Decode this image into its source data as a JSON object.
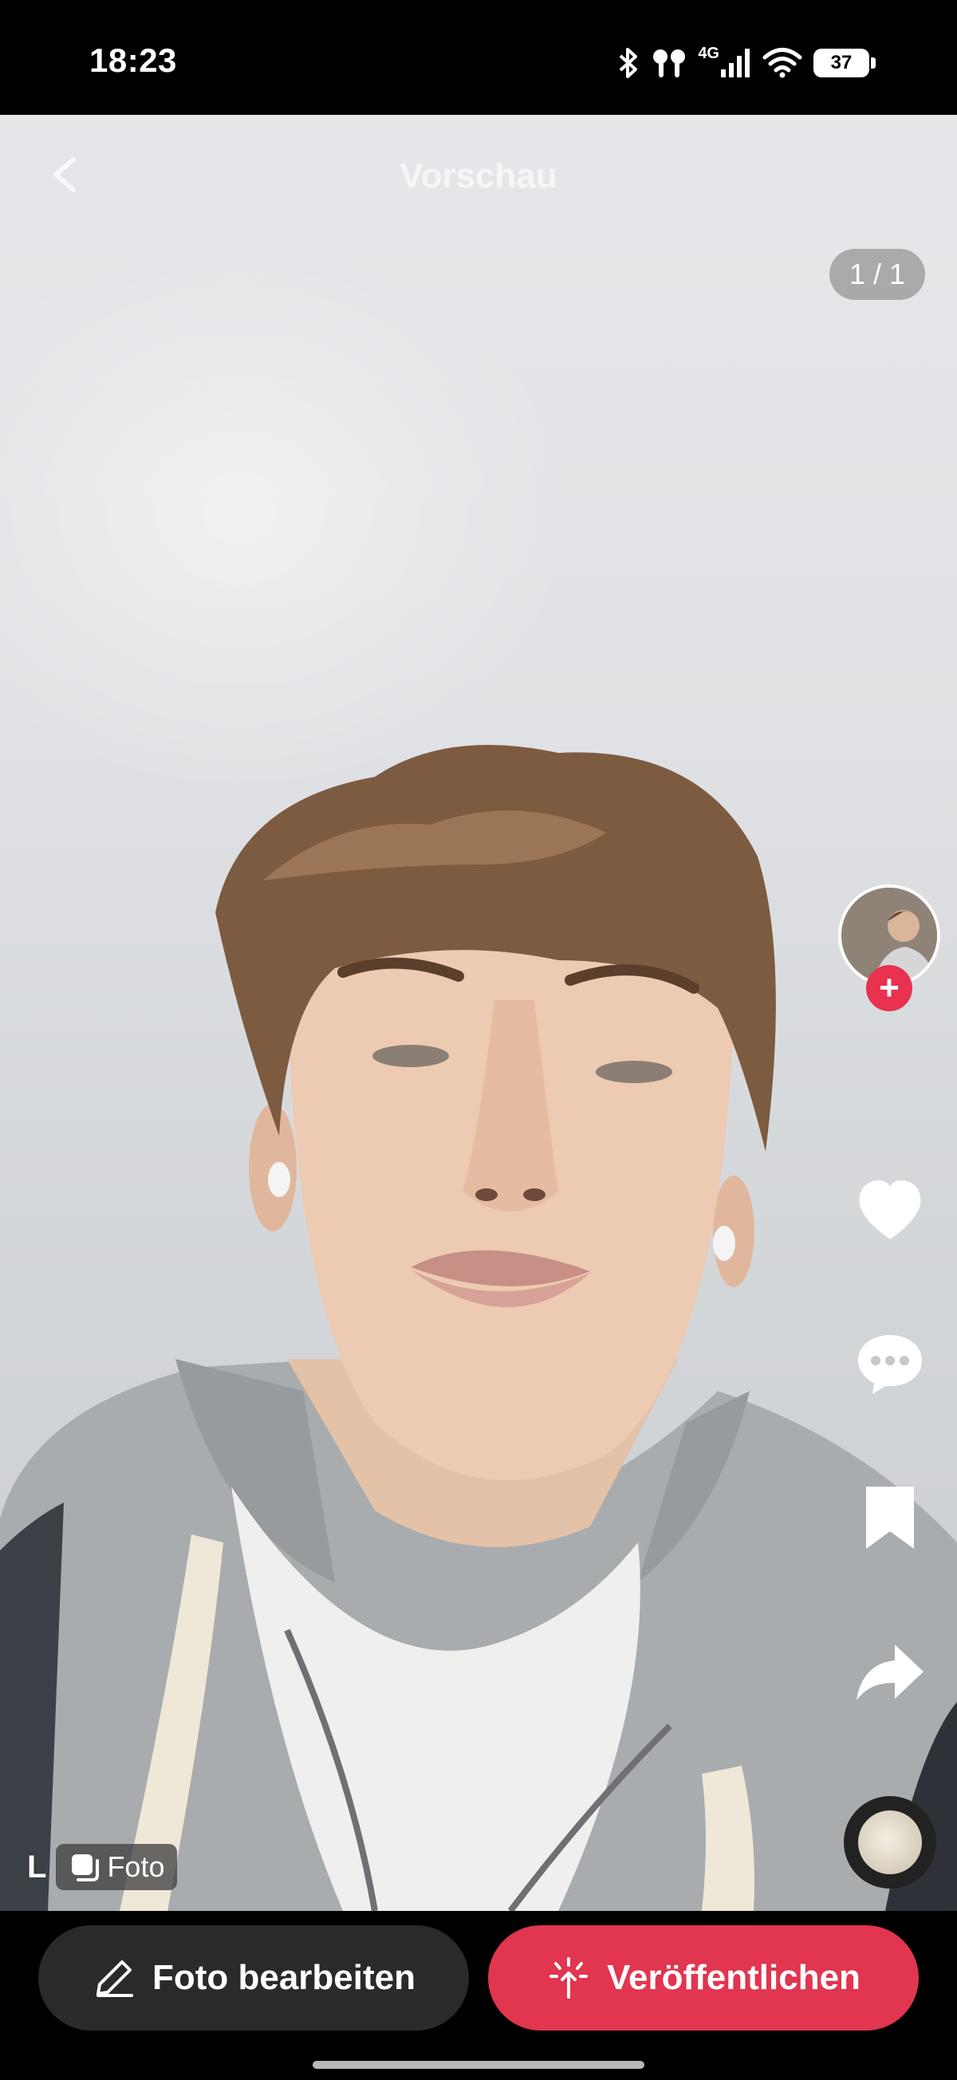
{
  "status_bar": {
    "time": "18:23",
    "network": "4G",
    "battery_level": "37",
    "icons": [
      "bluetooth-icon",
      "earbuds-icon",
      "signal-icon",
      "wifi-icon",
      "battery-icon"
    ]
  },
  "header": {
    "title": "Vorschau",
    "page_indicator": "1 / 1"
  },
  "side_rail": {
    "icons": [
      "avatar",
      "follow-plus-icon",
      "heart-icon",
      "comment-icon",
      "bookmark-icon",
      "share-icon",
      "sound-disc-icon"
    ],
    "follow_glyph": "+"
  },
  "media_badge": {
    "prefix": "L",
    "type_label": "Foto"
  },
  "actions": {
    "edit_label": "Foto bearbeiten",
    "publish_label": "Veröffentlichen"
  },
  "colors": {
    "accent": "#e13550",
    "edit_button": "#2a2a2a"
  }
}
